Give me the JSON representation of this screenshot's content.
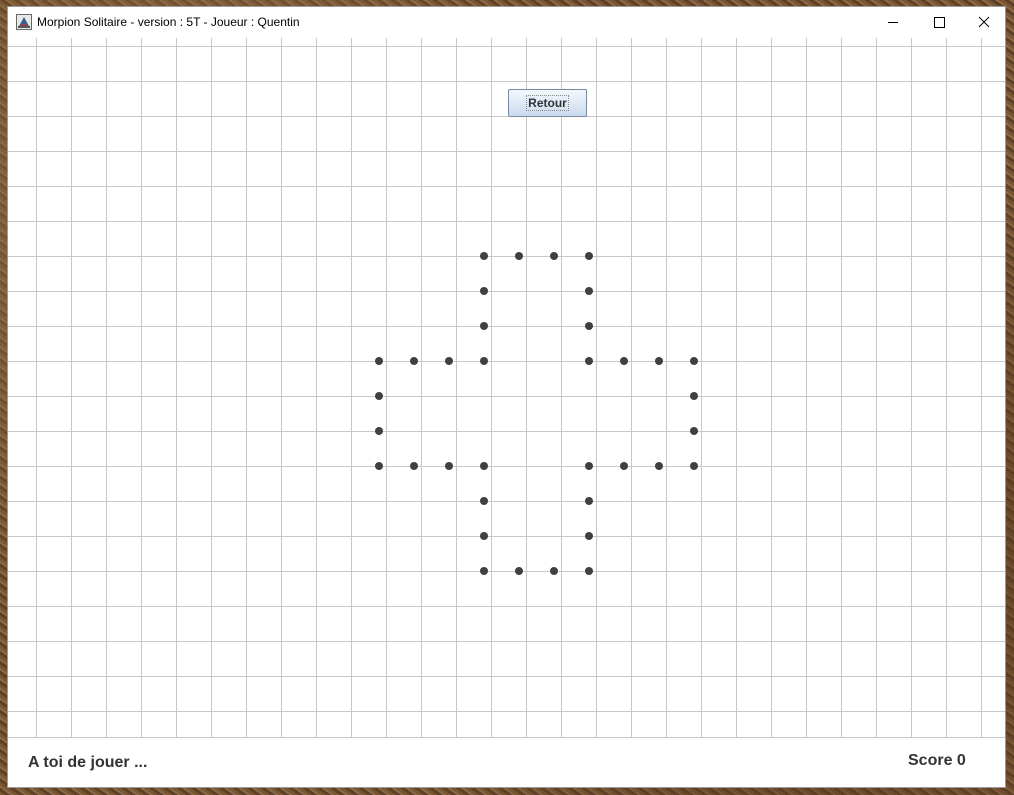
{
  "window": {
    "title": "Morpion Solitaire - version : 5T - Joueur : Quentin"
  },
  "icons": {
    "app": "java-app-icon",
    "minimize": "minimize-icon",
    "maximize": "maximize-icon",
    "close": "close-icon"
  },
  "toolbar": {
    "retour_label": "Retour"
  },
  "status": {
    "message": "A toi de jouer ...",
    "score_label": "Score",
    "score_value": "0",
    "score_text": "Score 0"
  },
  "colors": {
    "grid_line": "#c8c8c8",
    "dot": "#404040",
    "button_top": "#f4f8fd",
    "button_bottom": "#c9daef"
  },
  "board": {
    "dots": [
      [
        4,
        0
      ],
      [
        5,
        0
      ],
      [
        6,
        0
      ],
      [
        7,
        0
      ],
      [
        4,
        1
      ],
      [
        7,
        1
      ],
      [
        4,
        2
      ],
      [
        7,
        2
      ],
      [
        1,
        3
      ],
      [
        2,
        3
      ],
      [
        3,
        3
      ],
      [
        4,
        3
      ],
      [
        7,
        3
      ],
      [
        8,
        3
      ],
      [
        9,
        3
      ],
      [
        10,
        3
      ],
      [
        1,
        4
      ],
      [
        10,
        4
      ],
      [
        1,
        5
      ],
      [
        10,
        5
      ],
      [
        1,
        6
      ],
      [
        2,
        6
      ],
      [
        3,
        6
      ],
      [
        4,
        6
      ],
      [
        7,
        6
      ],
      [
        8,
        6
      ],
      [
        9,
        6
      ],
      [
        10,
        6
      ],
      [
        4,
        7
      ],
      [
        7,
        7
      ],
      [
        4,
        8
      ],
      [
        7,
        8
      ],
      [
        4,
        9
      ],
      [
        5,
        9
      ],
      [
        6,
        9
      ],
      [
        7,
        9
      ]
    ]
  }
}
